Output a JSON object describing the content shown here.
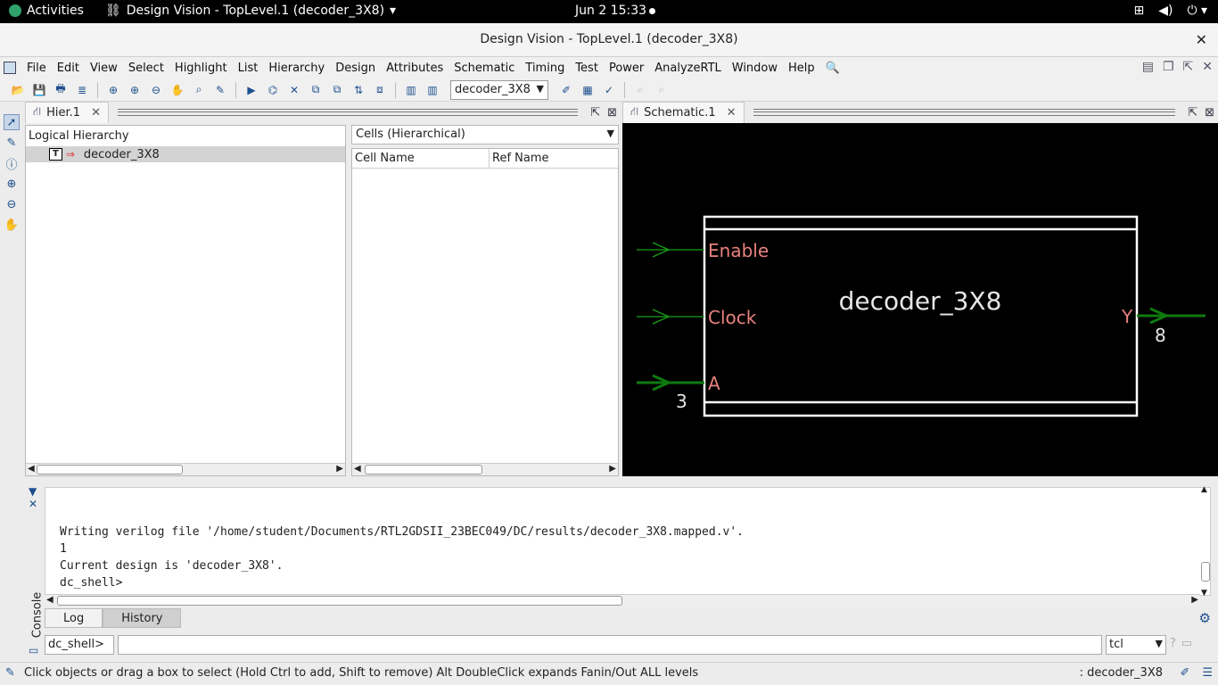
{
  "system_bar": {
    "activities": "Activities",
    "app_menu": "Design Vision - TopLevel.1 (decoder_3X8)",
    "clock": "Jun 2  15:33"
  },
  "window": {
    "title": "Design Vision - TopLevel.1 (decoder_3X8)",
    "close": "✕"
  },
  "menu": [
    "File",
    "Edit",
    "View",
    "Select",
    "Highlight",
    "List",
    "Hierarchy",
    "Design",
    "Attributes",
    "Schematic",
    "Timing",
    "Test",
    "Power",
    "AnalyzeRTL",
    "Window",
    "Help"
  ],
  "toolbar": {
    "design_select": "decoder_3X8"
  },
  "hier_panel": {
    "tab_label": "Hier.1",
    "logical_header": "Logical Hierarchy",
    "tree_badge": "T",
    "tree_item": "decoder_3X8",
    "cells_combo": "Cells (Hierarchical)",
    "columns": [
      "Cell Name",
      "Ref Name"
    ]
  },
  "schematic": {
    "tab_label": "Schematic.1",
    "cell_name": "decoder_3X8",
    "ports_in": [
      "Enable",
      "Clock",
      "A"
    ],
    "port_out": "Y",
    "bus_width_a": "3",
    "bus_width_y": "8",
    "colors": {
      "background": "#000000",
      "cell_border": "#ffffff",
      "cell_text": "#e6e6e6",
      "pin_label": "#e8827d",
      "net": "#16a016",
      "bus": "#0f7a0f"
    }
  },
  "console": {
    "lines": [
      "Writing verilog file '/home/student/Documents/RTL2GDSII_23BEC049/DC/results/decoder_3X8.mapped.v'.",
      "1",
      "Current design is 'decoder_3X8'.",
      "dc_shell>"
    ],
    "side_label": "Console",
    "tabs": [
      "Log",
      "History"
    ],
    "prompt": "dc_shell>",
    "language": "tcl"
  },
  "status_bar": {
    "message": "Click objects or drag a box to select (Hold Ctrl to add, Shift to remove) Alt DoubleClick expands Fanin/Out ALL levels",
    "current": ": decoder_3X8"
  }
}
